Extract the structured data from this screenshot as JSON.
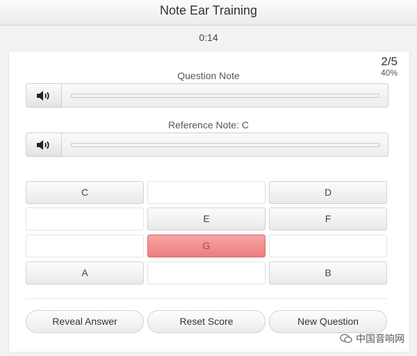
{
  "app": {
    "title": "Note Ear Training"
  },
  "timer": "0:14",
  "score": {
    "fraction": "2/5",
    "percent": "40%"
  },
  "question": {
    "label": "Question Note"
  },
  "reference": {
    "label": "Reference Note: C"
  },
  "notes": {
    "c": "C",
    "cs": "",
    "d": "D",
    "ds": "",
    "e": "E",
    "f": "F",
    "fs": "",
    "g": "G",
    "gs": "",
    "a": "A",
    "as": "",
    "b": "B"
  },
  "actions": {
    "reveal": "Reveal Answer",
    "reset": "Reset Score",
    "new_question": "New Question"
  },
  "watermark": "中国音响网",
  "colors": {
    "wrong_answer": "#f08a8a"
  },
  "icons": {
    "play": "speaker-icon",
    "watermark": "wechat-icon"
  }
}
